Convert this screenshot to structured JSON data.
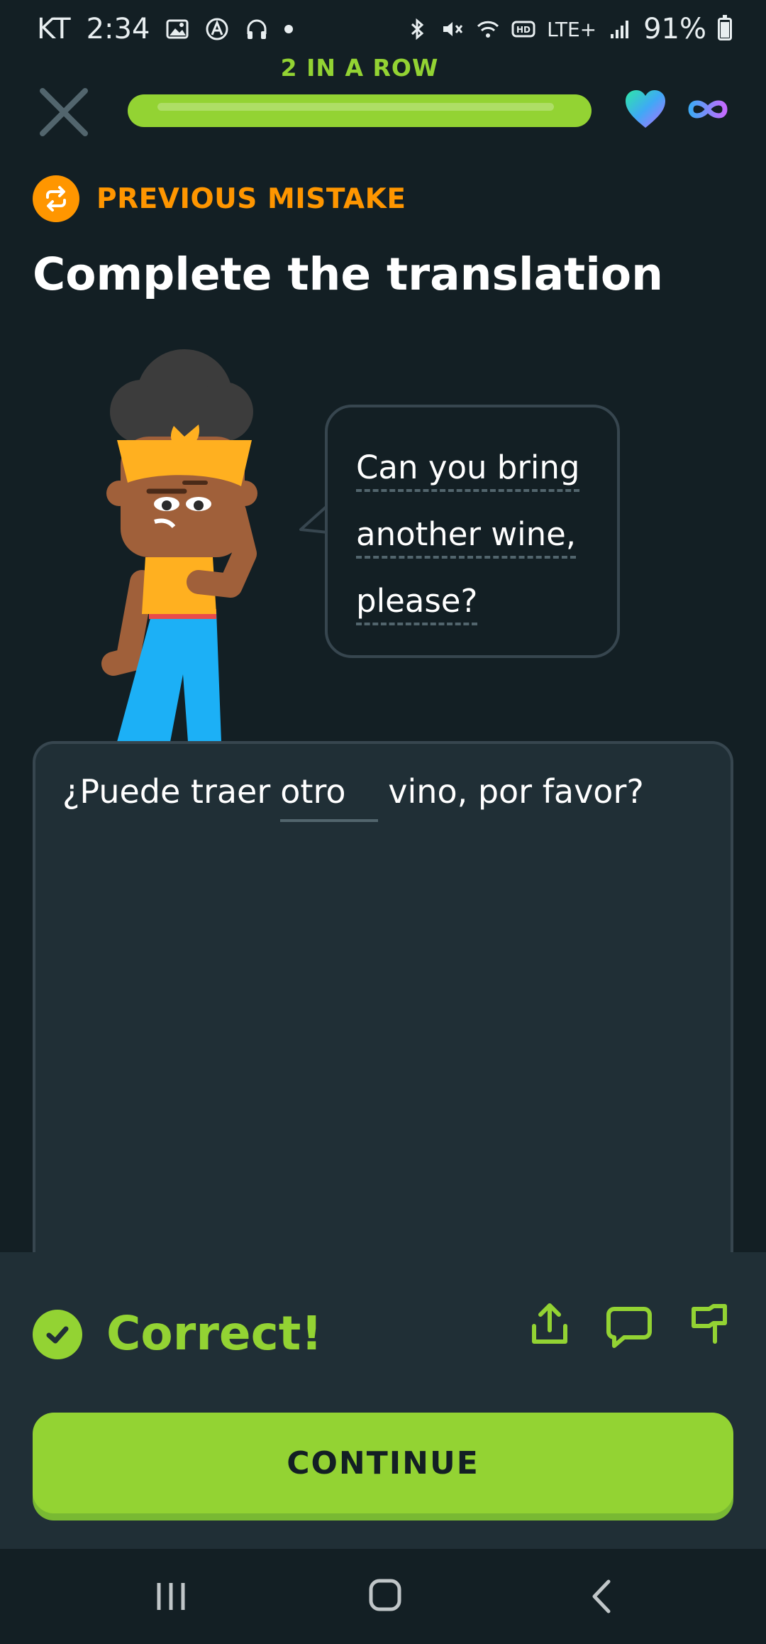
{
  "status_bar": {
    "carrier": "KT",
    "time": "2:34",
    "battery_percent": "91%",
    "battery_level": 0.91,
    "network": "LTE+"
  },
  "header": {
    "streak_text": "2 IN A ROW",
    "progress": 0.98,
    "hearts": "infinity"
  },
  "lesson": {
    "badge_text": "PREVIOUS MISTAKE",
    "title": "Complete the translation",
    "prompt_lines": [
      "Can you bring",
      "another wine,",
      "please?"
    ],
    "sentence_before": "¿Puede traer",
    "filled_word": "otro",
    "sentence_after": "vino, por favor?"
  },
  "feedback": {
    "status": "Correct!",
    "continue_label": "CONTINUE"
  },
  "colors": {
    "background": "#131f24",
    "card": "#202f36",
    "accent_green": "#93d333",
    "accent_orange": "#ff9600",
    "border": "#37464f"
  },
  "icons": [
    "close-icon",
    "heart-icon",
    "infinity-icon",
    "repeat-icon",
    "check-icon",
    "share-icon",
    "comment-icon",
    "flag-icon"
  ]
}
